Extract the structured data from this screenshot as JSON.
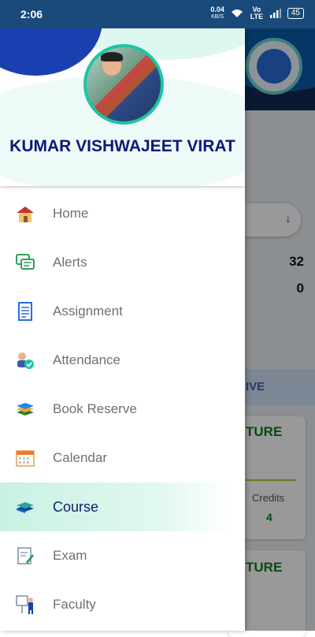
{
  "status_bar": {
    "time": "2:06",
    "net_speed": "0.04",
    "net_unit": "KB/S",
    "volte": "Vo LTE",
    "battery": "45"
  },
  "background": {
    "values": [
      "32",
      "0"
    ],
    "tab_text": "IVE",
    "card_title": "TURE",
    "credits_label": "Credits",
    "credits_value": "4",
    "card2_title": "TURE",
    "colors": {
      "header": "#102a55",
      "accent": "#117a1a"
    }
  },
  "drawer": {
    "user_name": "KUMAR VISHWAJEET VIRAT",
    "active_item": "Course",
    "items": [
      {
        "label": "Home",
        "icon": "home-icon"
      },
      {
        "label": "Alerts",
        "icon": "alerts-icon"
      },
      {
        "label": "Assignment",
        "icon": "assignment-icon"
      },
      {
        "label": "Attendance",
        "icon": "attendance-icon"
      },
      {
        "label": "Book Reserve",
        "icon": "book-reserve-icon"
      },
      {
        "label": "Calendar",
        "icon": "calendar-icon"
      },
      {
        "label": "Course",
        "icon": "course-icon"
      },
      {
        "label": "Exam",
        "icon": "exam-icon"
      },
      {
        "label": "Faculty",
        "icon": "faculty-icon"
      }
    ]
  }
}
